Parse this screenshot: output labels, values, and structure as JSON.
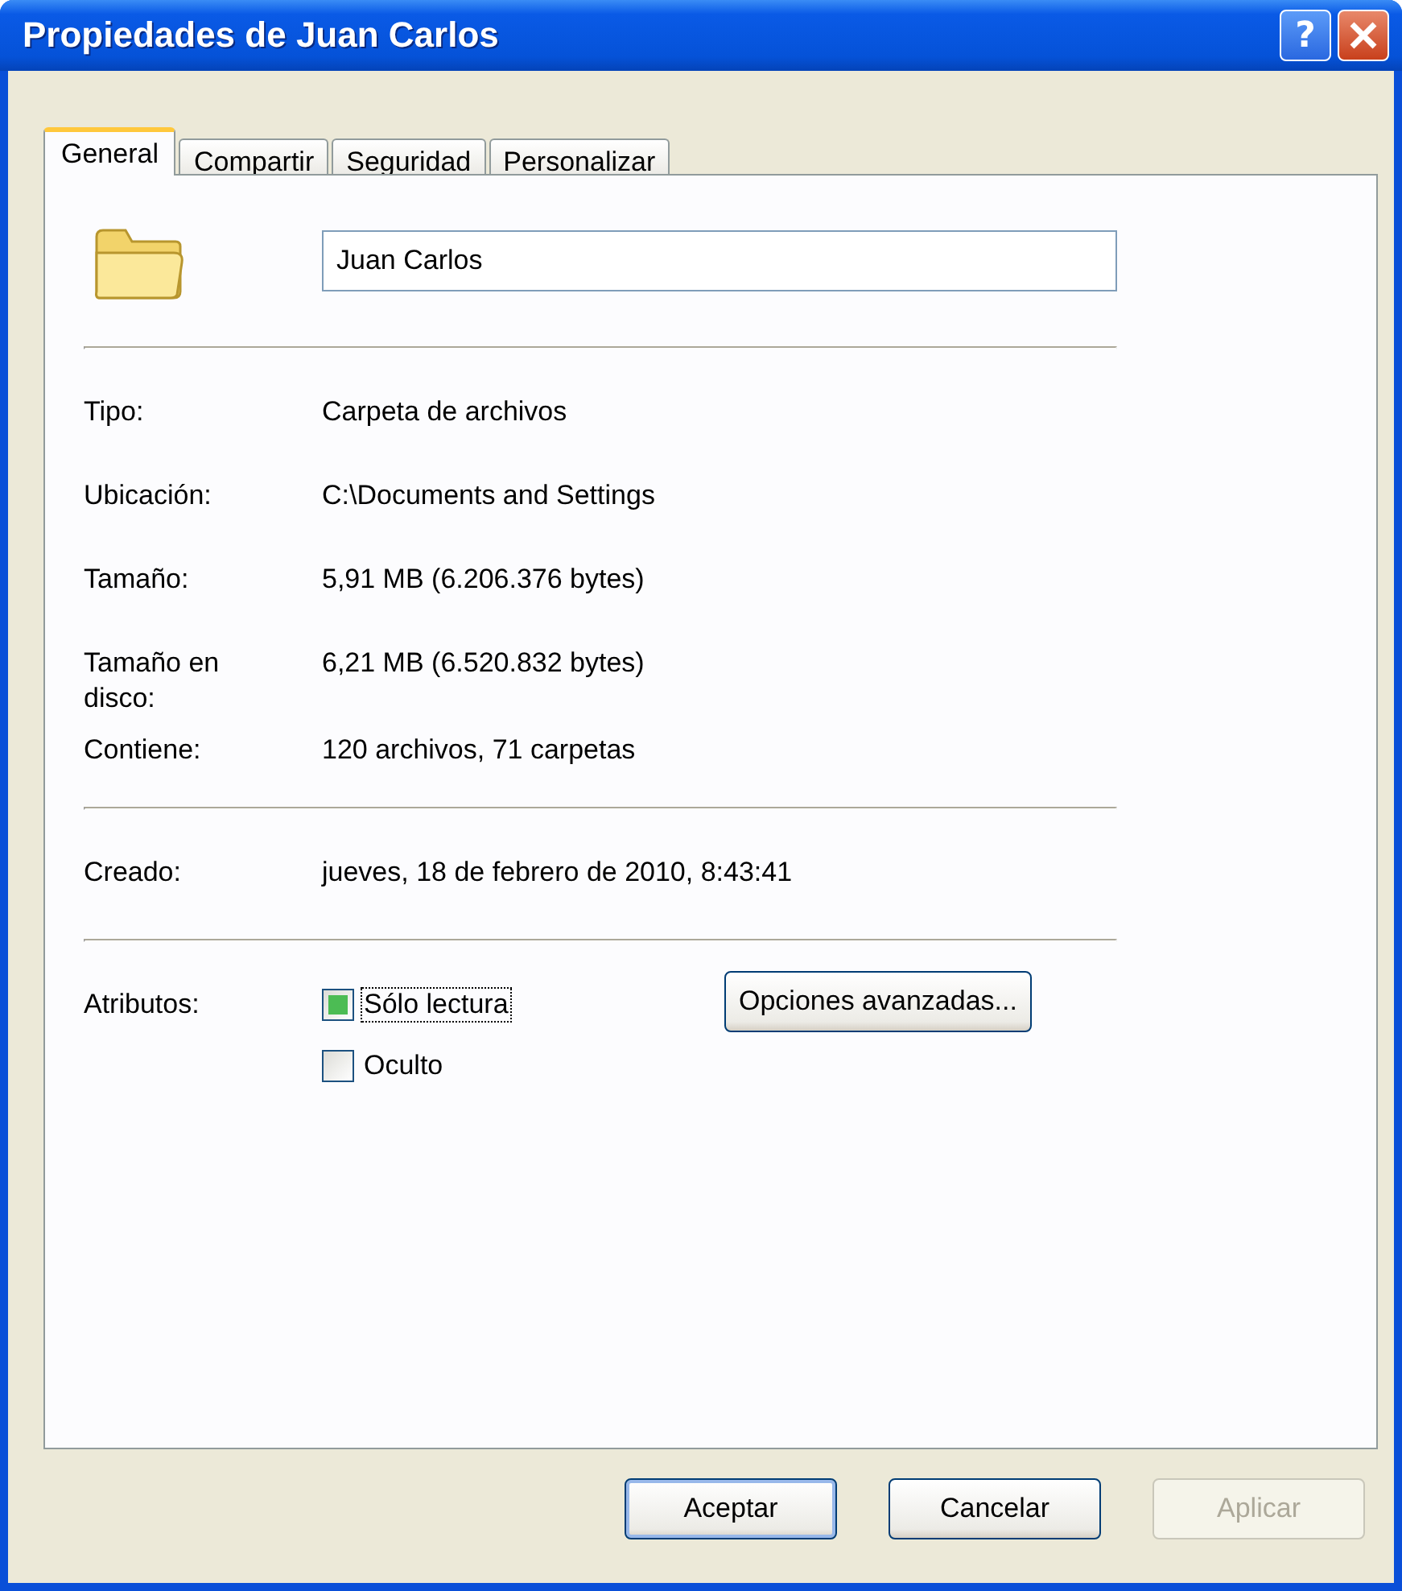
{
  "window": {
    "title": "Propiedades de Juan Carlos",
    "help_button": "?"
  },
  "tabs": [
    {
      "label": "General",
      "selected": true
    },
    {
      "label": "Compartir",
      "selected": false
    },
    {
      "label": "Seguridad",
      "selected": false
    },
    {
      "label": "Personalizar",
      "selected": false
    }
  ],
  "name_field": {
    "value": "Juan Carlos"
  },
  "sections": [
    [
      {
        "label": "Tipo:",
        "value": "Carpeta de archivos"
      },
      {
        "label": "Ubicación:",
        "value": "C:\\Documents and Settings"
      },
      {
        "label": "Tamaño:",
        "value": "5,91 MB (6.206.376 bytes)"
      },
      {
        "label": "Tamaño en disco:",
        "value": "6,21 MB (6.520.832 bytes)"
      },
      {
        "label": "Contiene:",
        "value": "120 archivos, 71 carpetas"
      }
    ],
    [
      {
        "label": "Creado:",
        "value": "jueves, 18 de febrero de 2010, 8:43:41"
      }
    ]
  ],
  "attributes": {
    "label": "Atributos:",
    "checkboxes": [
      {
        "label": "Sólo lectura",
        "checked": false,
        "mixed": true,
        "focused": true
      },
      {
        "label": "Oculto",
        "checked": false,
        "mixed": false,
        "focused": false
      }
    ],
    "advanced_button": "Opciones avanzadas..."
  },
  "buttons": [
    {
      "label": "Aceptar",
      "disabled": false,
      "default": true
    },
    {
      "label": "Cancelar",
      "disabled": false,
      "default": false
    },
    {
      "label": "Aplicar",
      "disabled": true,
      "default": false
    }
  ]
}
